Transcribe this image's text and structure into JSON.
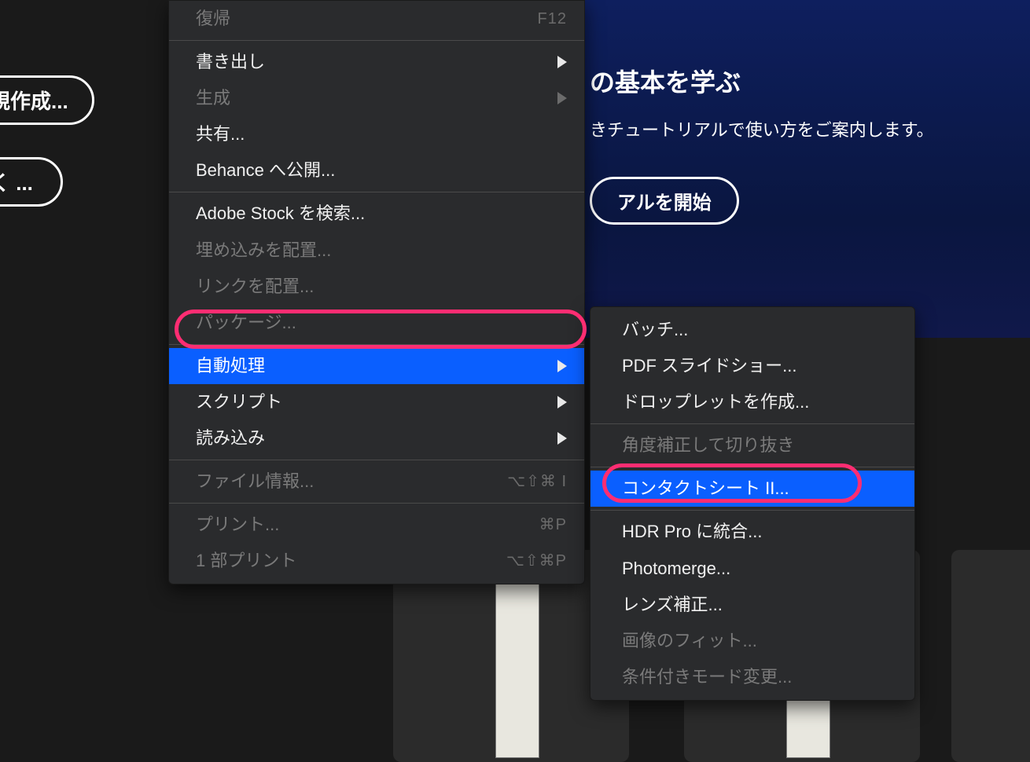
{
  "hero": {
    "title_fragment": "の基本を学ぶ",
    "subtitle_fragment": "きチュートリアルで使い方をご案内します。",
    "button_fragment": "アルを開始"
  },
  "left_buttons": {
    "new": "規作成...",
    "open": "く ..."
  },
  "menu": {
    "revert": "復帰",
    "revert_sc": "F12",
    "export": "書き出し",
    "generate": "生成",
    "share": "共有...",
    "behance": "Behance へ公開...",
    "stock": "Adobe Stock を検索...",
    "place_embed": "埋め込みを配置...",
    "place_link": "リンクを配置...",
    "package": "パッケージ...",
    "automate": "自動処理",
    "scripts": "スクリプト",
    "import": "読み込み",
    "file_info": "ファイル情報...",
    "file_info_sc": "⌥⇧⌘ I",
    "print": "プリント...",
    "print_sc": "⌘P",
    "print_one": "1 部プリント",
    "print_one_sc": "⌥⇧⌘P"
  },
  "submenu": {
    "batch": "バッチ...",
    "pdf": "PDF スライドショー...",
    "droplet": "ドロップレットを作成...",
    "crop_straighten": "角度補正して切り抜き",
    "contact_sheet": "コンタクトシート II...",
    "hdr": "HDR Pro に統合...",
    "photomerge": "Photomerge...",
    "lens": "レンズ補正...",
    "fit_image": "画像のフィット...",
    "cond_mode": "条件付きモード変更..."
  }
}
